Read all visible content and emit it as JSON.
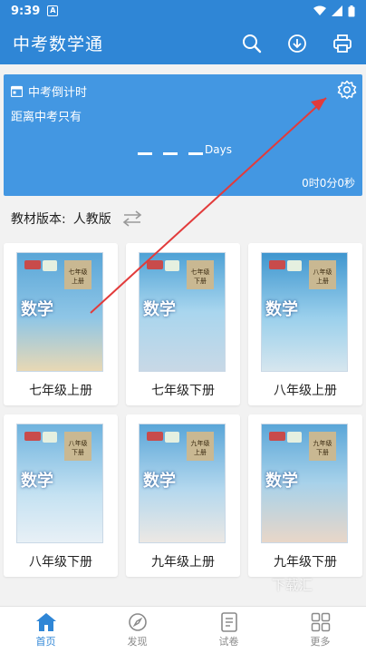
{
  "status_bar": {
    "time": "9:39",
    "notification_icon": "a-icon"
  },
  "app_bar": {
    "title": "中考数学通",
    "actions": [
      "search-icon",
      "download-icon",
      "printer-icon"
    ]
  },
  "countdown": {
    "header": "中考倒计时",
    "subtitle": "距离中考只有",
    "days_label": "Days",
    "time_left": "0时0分0秒"
  },
  "version": {
    "label": "教材版本:",
    "value": "人教版"
  },
  "books": [
    {
      "label": "七年级上册",
      "grade": "七年级 上册",
      "cover_color": "#6aa8cf"
    },
    {
      "label": "七年级下册",
      "grade": "七年级 下册",
      "cover_color": "#7cc4e6"
    },
    {
      "label": "八年级上册",
      "grade": "八年级 上册",
      "cover_color": "#5aa7d6"
    },
    {
      "label": "八年级下册",
      "grade": "八年级 下册",
      "cover_color": "#86c0e0"
    },
    {
      "label": "九年级上册",
      "grade": "九年级 上册",
      "cover_color": "#7db6d8"
    },
    {
      "label": "九年级下册",
      "grade": "九年级 下册",
      "cover_color": "#74b9dc"
    }
  ],
  "cover_title": "数学",
  "watermark": "下载汇",
  "bottom_nav": [
    {
      "label": "首页",
      "icon": "home-icon",
      "active": true
    },
    {
      "label": "发现",
      "icon": "compass-icon",
      "active": false
    },
    {
      "label": "试卷",
      "icon": "paper-icon",
      "active": false
    },
    {
      "label": "更多",
      "icon": "grid-icon",
      "active": false
    }
  ],
  "colors": {
    "primary": "#2f86d6",
    "card": "#4397e2",
    "arrow": "#e23b3b"
  }
}
